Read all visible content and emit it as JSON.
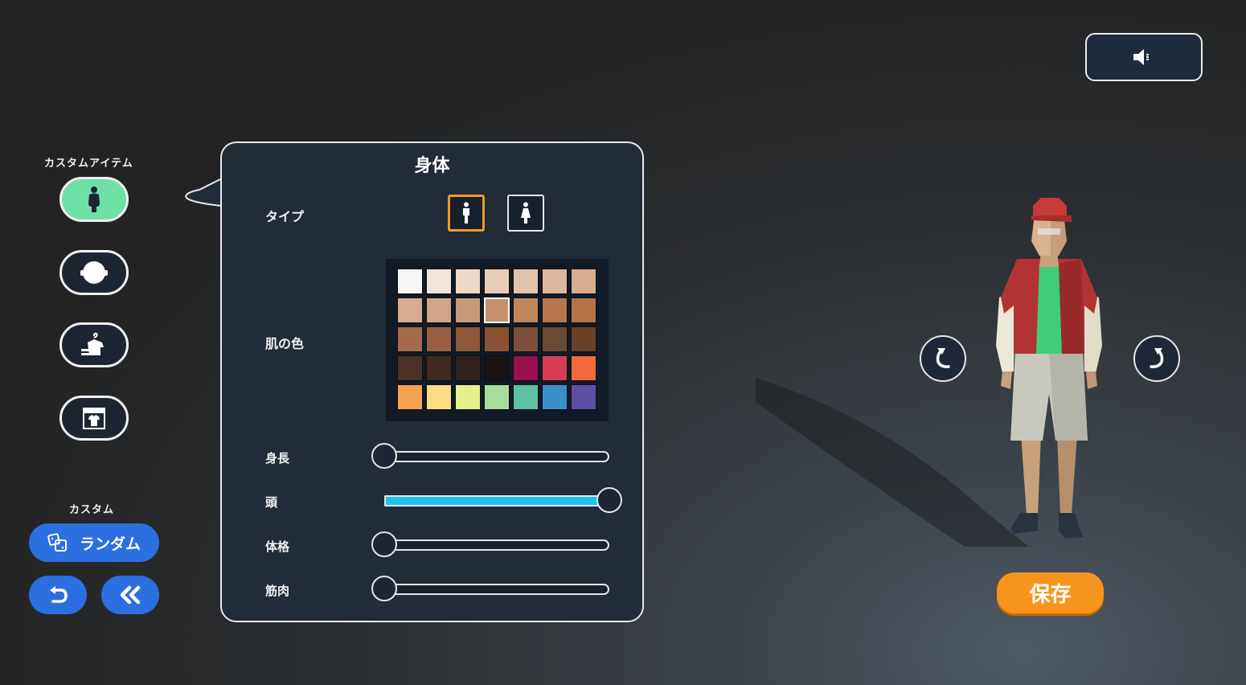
{
  "sound": {
    "icon": "speaker-icon"
  },
  "sidebar": {
    "custom_items_label": "カスタムアイテム",
    "items": [
      {
        "name": "body",
        "icon": "body-icon",
        "active": true
      },
      {
        "name": "head",
        "icon": "head-icon",
        "active": false
      },
      {
        "name": "outfit",
        "icon": "clothes-hanger-icon",
        "active": false
      },
      {
        "name": "shop",
        "icon": "shop-icon",
        "active": false
      }
    ],
    "custom_label": "カスタム",
    "random_label": "ランダム",
    "undo_icon": "undo-icon",
    "reset_icon": "double-chevron-left-icon"
  },
  "panel": {
    "title": "身体",
    "type_label": "タイプ",
    "types": [
      {
        "icon": "male-figure-icon",
        "selected": true
      },
      {
        "icon": "female-figure-icon",
        "selected": false
      }
    ],
    "skin_label": "肌の色",
    "skin_colors": [
      "#f7f7f7",
      "#f1e4db",
      "#ecd9c8",
      "#e9ccb8",
      "#e2c3ae",
      "#dcb79c",
      "#d6ae8f",
      "#d5ac90",
      "#d3a488",
      "#c99a79",
      "#c89169",
      "#c18659",
      "#b8774b",
      "#b57348",
      "#a56a4a",
      "#9a5e41",
      "#8d5738",
      "#8a5232",
      "#7b4f3b",
      "#6e4a35",
      "#6a4124",
      "#4c3226",
      "#402a21",
      "#30221c",
      "#1c1412",
      "#9a0f4f",
      "#d63d52",
      "#f26a3c",
      "#f5a253",
      "#fddc86",
      "#e3f08c",
      "#a6dd9b",
      "#5dc1a3",
      "#3a8fcb",
      "#5e4fa4"
    ],
    "selected_skin_index": 10,
    "sliders": [
      {
        "label": "身長",
        "value": 0
      },
      {
        "label": "頭",
        "value": 1
      },
      {
        "label": "体格",
        "value": 0
      },
      {
        "label": "筋肉",
        "value": 0
      }
    ]
  },
  "preview": {
    "rotate_left_icon": "rotate-left-icon",
    "rotate_right_icon": "rotate-right-icon",
    "save_label": "保存"
  }
}
